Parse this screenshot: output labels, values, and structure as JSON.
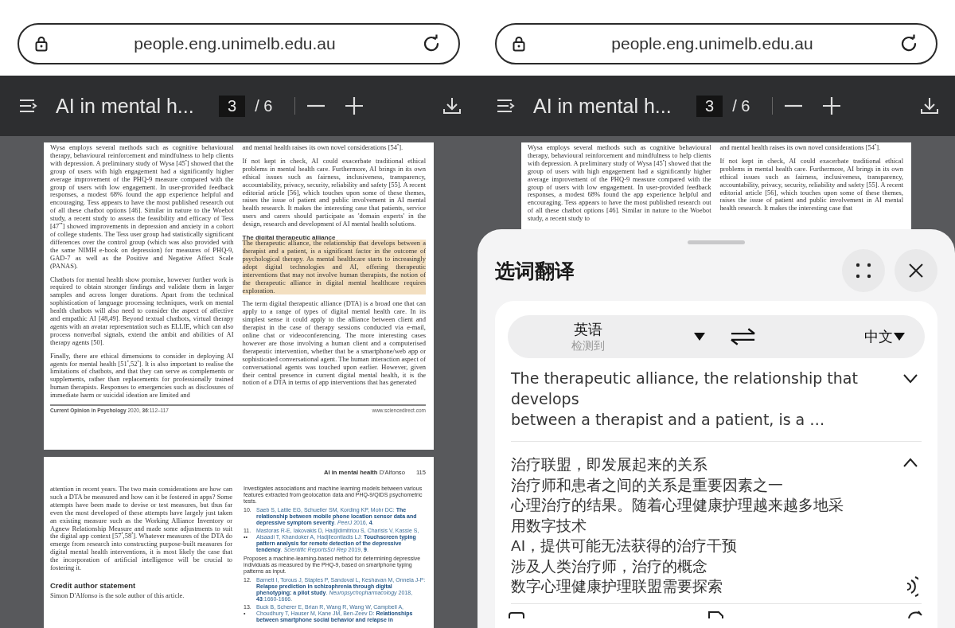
{
  "phones": [
    {
      "url": "people.eng.unimelb.edu.au",
      "toolbar": {
        "title": "AI in mental h...",
        "page": "3",
        "total": "/ 6"
      },
      "pages": [
        {
          "columns": [
            [
              {
                "kind": "body",
                "text": "Wysa employs several methods such as cognitive behavioural therapy, behavioural reinforcement and mindfulness to help clients with depression. A preliminary study of Wysa [45$^{•}$] showed that the group of users with high engagement had a significantly higher average improvement of the PHQ-9 measure compared with the group of users with low engagement. In user-provided feedback responses, a modest 68% found the app experience helpful and encouraging. Tess appears to have the most published research out of all these chatbot options [46]. Similar in nature to the Woebot study, a recent study to assess the feasibility and efficacy of Tess [47$^{••}$] showed improvements in depression and anxiety in a cohort of college students. The Tess user group had statistically significant differences over the control group (which was also provided with the same NIMH e-book on depression) for measures of PHQ-9, GAD-7 as well as the Positive and Negative Affect Scale (PANAS)."
              },
              {
                "kind": "body",
                "text": "Chatbots for mental health show promise, however further work is required to obtain stronger findings and validate them in larger samples and across longer durations. Apart from the technical sophistication of language processing techniques, work on mental health chatbots will also need to consider the aspect of affective and empathic AI [48,49]. Beyond textual chatbots, virtual therapy agents with an avatar representation such as ELLIE, which can also process nonverbal signals, extend the ambit and abilities of AI therapy agents [50]."
              },
              {
                "kind": "body",
                "text": "Finally, there are ethical dimensions to consider in deploying AI agents for mental health [51$^{•}$,52$^{•}$]. It is also important to realise the limitations of chatbots, and that they can serve as complements or supplements, rather than replacements for professionally trained human therapists. Responses to emergencies such as disclosures of immediate harm or suicidal ideation are limited and"
              }
            ],
            [
              {
                "kind": "body",
                "text": "and mental health raises its own novel considerations [54$^{•}$]."
              },
              {
                "kind": "body",
                "text": "If not kept in check, AI could exacerbate traditional ethical problems in mental health care. Furthermore, AI brings in its own ethical issues such as fairness, inclusiveness, transparency, accountability, privacy, security, reliability and safety [55]. A recent editorial article [56], which touches upon some of these themes, raises the issue of patient and public involvement in AI mental health research. It makes the interesting case that patients, service users and carers should participate as 'domain experts' in the design, research and development of AI mental health solutions."
              },
              {
                "kind": "heading",
                "text": "The digital therapeutic alliance"
              },
              {
                "kind": "highlight",
                "text": "The therapeutic alliance, the relationship that develops between a therapist and a patient, is a significant factor in the outcome of psychological therapy. As mental healthcare starts to increasingly adopt digital technologies and AI, offering therapeutic interventions that may not involve human therapists, the notion of the therapeutic alliance in digital mental healthcare requires exploration."
              },
              {
                "kind": "body",
                "text": "The term digital therapeutic alliance (DTA) is a broad one that can apply to a range of types of digital mental health care. In its simplest sense it could apply to the alliance between client and therapist in the case of therapy sessions conducted via e-mail, online chat or videoconferencing. The more interesting cases however are those involving a human client and a computerised therapeutic intervention, whether that be a smartphone/web app or sophisticated conversational agent. The human interaction aspect of conversational agents was touched upon earlier. However, given their central presence in current digital mental health, it is the notion of a DTA in terms of app interventions that has generated"
              }
            ]
          ],
          "footer_left": "**Current Opinion in Psychology** 2020, **36**:112–117",
          "footer_right": "www.sciencedirect.com"
        },
        {
          "header": "**AI in mental health** D'Alfonso",
          "page_number": "115",
          "columns": [
            [
              {
                "kind": "body",
                "text": "attention in recent years. The two main considerations are how can such a DTA be measured and how can it be fostered in apps? Some attempts have been made to devise or test measures, but thus far even the most developed of these attempts have largely just taken an existing measure such as the Working Alliance Inventory or Agnew Relationship Measure and made some adjustments to suit the digital app context [57$^{•}$,58$^{•}$]. Whatever measures of the DTA do emerge from research into constructing purpose-built measures for digital mental health interventions, it is most likely the case that the incorporation of artificial intelligence will be crucial to fostering it."
              },
              {
                "kind": "section",
                "text": "Credit author statement"
              },
              {
                "kind": "body",
                "text": "Simon D'Alfonso is the sole author of this article."
              }
            ],
            [
              {
                "kind": "note",
                "text": "Investigates associations and machine learning models between various features extracted from geolocation data and PHQ-9/QIDS psychometric tests."
              },
              {
                "kind": "reference",
                "number": "10.",
                "text": "Saeb S, Lattie EG, Schueller SM, Kording KP, Mohr DC: **The relationship between mobile phone location sensor data and depressive symptom severity**. *PeerJ* 2016, **4**."
              },
              {
                "kind": "reference",
                "number": "11.",
                "mark": "••",
                "text": "Mastoras R-E, Iakovakis D, Hadjidimitriou S, Charisis V, Kassie S, Alsaadi T, Khandoker A, Hadjileontiadis LJ: **Touchscreen typing pattern analysis for remote detection of the depressive tendency**. *Scientific ReportsSci Rep* 2019, **9**."
              },
              {
                "kind": "note",
                "text": "Proposes a machine-learning-based method for determining depressive individuals as measured by the PHQ-9, based on smartphone typing patterns as input."
              },
              {
                "kind": "reference",
                "number": "12.",
                "text": "Barnett I, Torous J, Staples P, Sandoval L, Keshavan M, Onnela J-P: **Relapse prediction in schizophrenia through digital phenotyping: a pilot study**. *Neuropsychopharmacology* 2018, **43**:1660-1666."
              },
              {
                "kind": "reference",
                "number": "13.",
                "mark": "•",
                "text": "Buck B, Scherer E, Brian R, Wang R, Wang W, Campbell A, Choudhury T, Hauser M, Kane JM, Ben-Zeev D: **Relationships between smartphone social behavior and relapse in**"
              }
            ]
          ]
        }
      ]
    },
    {
      "url": "people.eng.unimelb.edu.au",
      "toolbar": {
        "title": "AI in mental h...",
        "page": "3",
        "total": "/ 6"
      },
      "pages": [
        {
          "columns": [
            [
              {
                "kind": "body",
                "text": "Wysa employs several methods such as cognitive behavioural therapy, behavioural reinforcement and mindfulness to help clients with depression. A preliminary study of Wysa [45$^{•}$] showed that the group of users with high engagement had a significantly higher average improvement of the PHQ-9 measure compared with the group of users with low engagement. In user-provided feedback responses, a modest 68% found the app experience helpful and encouraging. Tess appears to have the most published research out of all these chatbot options [46]. Similar in nature to the Woebot study, a recent study to"
              }
            ],
            [
              {
                "kind": "body",
                "text": "and mental health raises its own novel considerations [54$^{•}$]."
              },
              {
                "kind": "body",
                "text": "If not kept in check, AI could exacerbate traditional ethical problems in mental health care. Furthermore, AI brings in its own ethical issues such as fairness, inclusiveness, transparency, accountability, privacy, security, reliability and safety [55]. A recent editorial article [56], which touches upon some of these themes, raises the issue of patient and public involvement in AI mental health research. It makes the interesting case that"
              }
            ]
          ]
        }
      ],
      "translation_panel": {
        "title": "选词翻译",
        "source_language": {
          "name": "英语",
          "note": "检测到"
        },
        "target_language": "中文",
        "source": {
          "text": "The therapeutic alliance, the relationship that\ndevelops\nbetween a therapist and a patient, is a …",
          "expanded": false
        },
        "translation": {
          "lines": [
            "治疗联盟，即发展起来的关系",
            "治疗师和患者之间的关系是重要因素之一",
            "心理治疗的结果。随着心理健康护理越来越多地采",
            "用数字技术",
            "AI，提供可能无法获得的治疗干预",
            "涉及人类治疗师，治疗的概念",
            "数字心理健康护理联盟需要探索"
          ],
          "expanded": true
        }
      }
    }
  ]
}
